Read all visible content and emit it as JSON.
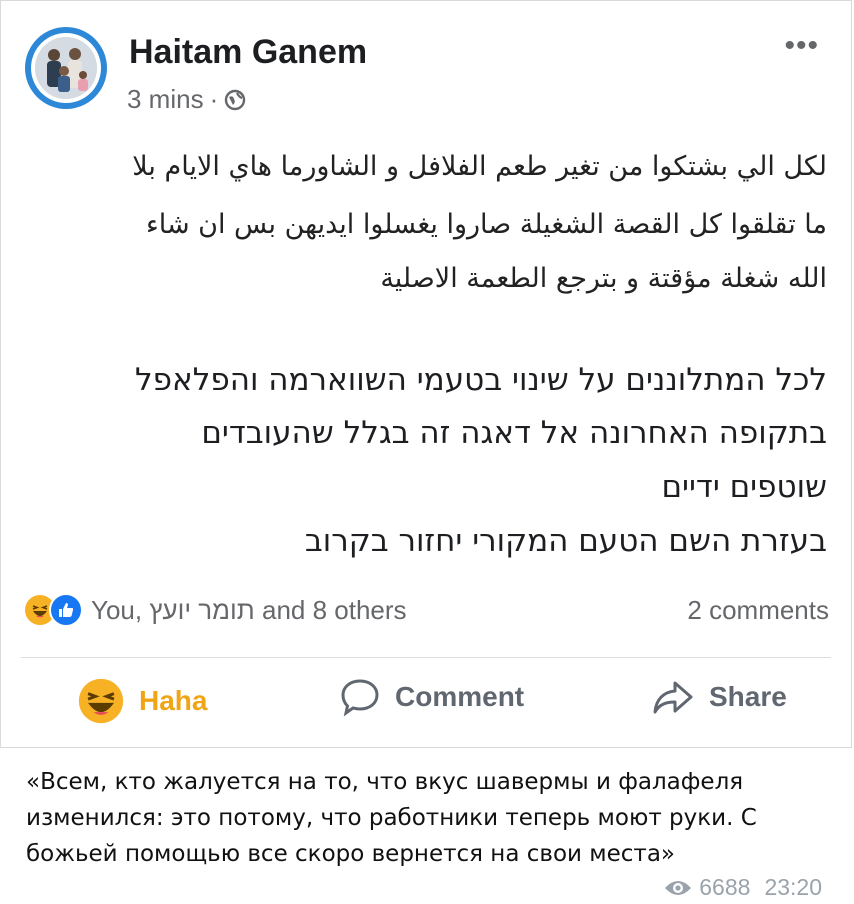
{
  "post": {
    "author": "Haitam Ganem",
    "time": "3 mins",
    "separator": "·",
    "more_label": "•••",
    "arabic_lines": [
      "لكل الي بشتكوا من تغير طعم الفلافل و الشاورما هاي الايام بلا",
      "ما تقلقوا كل القصة الشغيلة صاروا يغسلوا ايديهن بس ان شاء",
      "الله شغلة مؤقتة و بترجع الطعمة الاصلية"
    ],
    "hebrew_lines": [
      "לכל המתלוננים על שינוי בטעמי השווארמה והפלאפל",
      "בתקופה האחרונה אל דאגה זה בגלל שהעובדים",
      "שוטפים ידיים",
      "בעזרת השם הטעם המקורי יחזור בקרוב"
    ],
    "reactions_text": "You, תומר יועץ and 8 others",
    "comments_count": "2 comments",
    "actions": {
      "haha": "Haha",
      "comment": "Comment",
      "share": "Share"
    },
    "colors": {
      "haha_active": "#f0a517",
      "like_blue": "#1877f2",
      "author": "#1c1e21",
      "secondary": "#65676b"
    }
  },
  "caption": {
    "text": "«Всем, кто жалуется на то, что вкус шавермы и фалафеля изменился: это потому, что работники теперь моют руки. С божьей помощью все скоро вернется на свои места»"
  },
  "footer": {
    "views": "6688",
    "time": "23:20"
  }
}
